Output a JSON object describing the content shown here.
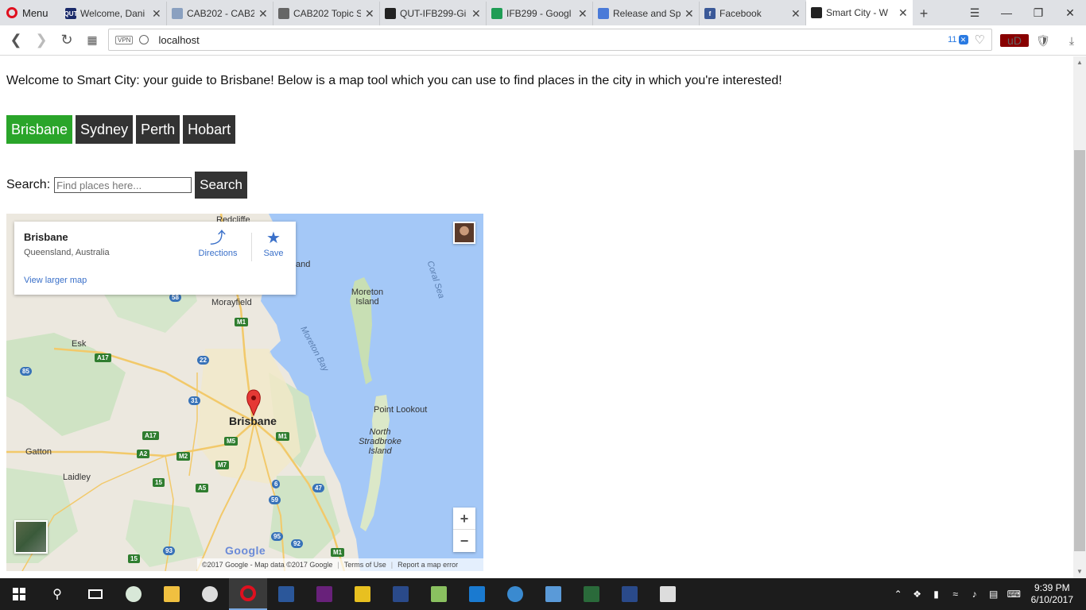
{
  "browser": {
    "menu_label": "Menu",
    "tabs": [
      {
        "title": "Welcome, Dani",
        "fav_color": "#1a2a6a",
        "fav_text": "QUT"
      },
      {
        "title": "CAB202 - CAB2",
        "fav_color": "#8aa0c0",
        "fav_text": ""
      },
      {
        "title": "CAB202 Topic S",
        "fav_color": "#666666",
        "fav_text": ""
      },
      {
        "title": "QUT-IFB299-Gi",
        "fav_color": "#222222",
        "fav_text": ""
      },
      {
        "title": "IFB299 - Googl",
        "fav_color": "#1f9d55",
        "fav_text": ""
      },
      {
        "title": "Release and Sp",
        "fav_color": "#4a7ad8",
        "fav_text": ""
      },
      {
        "title": "Facebook",
        "fav_color": "#3b5998",
        "fav_text": "f"
      },
      {
        "title": "Smart City - W",
        "fav_color": "#222222",
        "fav_text": ""
      }
    ],
    "url": "localhost",
    "vpn_label": "VPN",
    "tracker_count": "11"
  },
  "page": {
    "intro": "Welcome to Smart City: your guide to Brisbane! Below is a map tool which you can use to find places in the city in which you're interested!",
    "cities": [
      {
        "label": "Brisbane",
        "active": true
      },
      {
        "label": "Sydney",
        "active": false
      },
      {
        "label": "Perth",
        "active": false
      },
      {
        "label": "Hobart",
        "active": false
      }
    ],
    "search": {
      "label": "Search:",
      "placeholder": "Find places here...",
      "button": "Search"
    }
  },
  "map": {
    "place_title": "Brisbane",
    "place_sub": "Queensland, Australia",
    "directions": "Directions",
    "save": "Save",
    "larger_map": "View larger map",
    "labels": {
      "coral_sea": "Coral Sea",
      "moreton_island": "Moreton Island",
      "moreton_bay": "Moreton Bay",
      "morayfield": "Morayfield",
      "esk": "Esk",
      "brisbane": "Brisbane",
      "point_lookout": "Point Lookout",
      "north_stradbroke": "North Stradbroke Island",
      "gatton": "Gatton",
      "laidley": "Laidley",
      "land_fragment": "and",
      "redcliffe_fragment": "Redcliffe"
    },
    "google": "Google",
    "footer": {
      "data": "©2017 Google - Map data ©2017 Google",
      "terms": "Terms of Use",
      "report": "Report a map error"
    },
    "zoom_in": "+",
    "zoom_out": "−"
  },
  "taskbar": {
    "time": "9:39 PM",
    "date": "6/10/2017"
  }
}
